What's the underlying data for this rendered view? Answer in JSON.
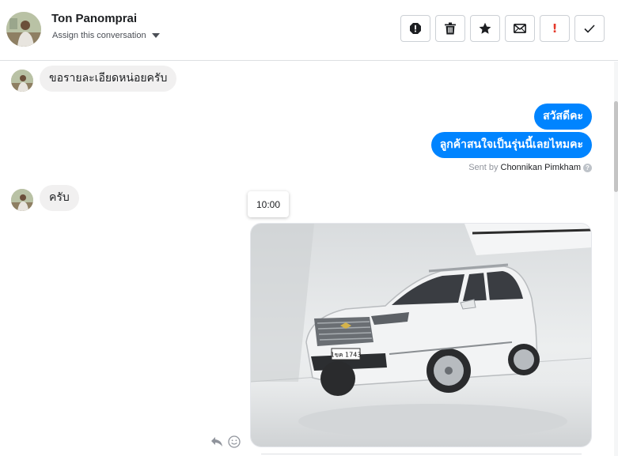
{
  "header": {
    "contact_name": "Ton Panomprai",
    "assign_label": "Assign this conversation",
    "actions": [
      {
        "name": "report-spam-icon",
        "label": "Report"
      },
      {
        "name": "trash-icon",
        "label": "Delete"
      },
      {
        "name": "star-icon",
        "label": "Star"
      },
      {
        "name": "envelope-icon",
        "label": "Mark unread"
      },
      {
        "name": "exclamation-icon",
        "label": "!"
      },
      {
        "name": "check-icon",
        "label": "Done"
      }
    ],
    "important_glyph": "!"
  },
  "messages": [
    {
      "direction": "in",
      "text": "ขอรายละเอียดหน่อยครับ"
    },
    {
      "direction": "out",
      "text": "สวัสดีคะ"
    },
    {
      "direction": "out",
      "text": "ลูกค้าสนใจเป็นรุ่นนี้เลยไหมคะ"
    },
    {
      "direction": "in",
      "text": "ครับ"
    }
  ],
  "sent_by": {
    "prefix": "Sent by",
    "agent": "Chonnikan Pimkham",
    "help": "?"
  },
  "time_tooltip": "10:00",
  "photo": {
    "plate_text": "1ขค 1743"
  },
  "colors": {
    "outgoing": "#0084ff",
    "incoming": "#f1f0f0",
    "accent_red": "#e4392b"
  }
}
